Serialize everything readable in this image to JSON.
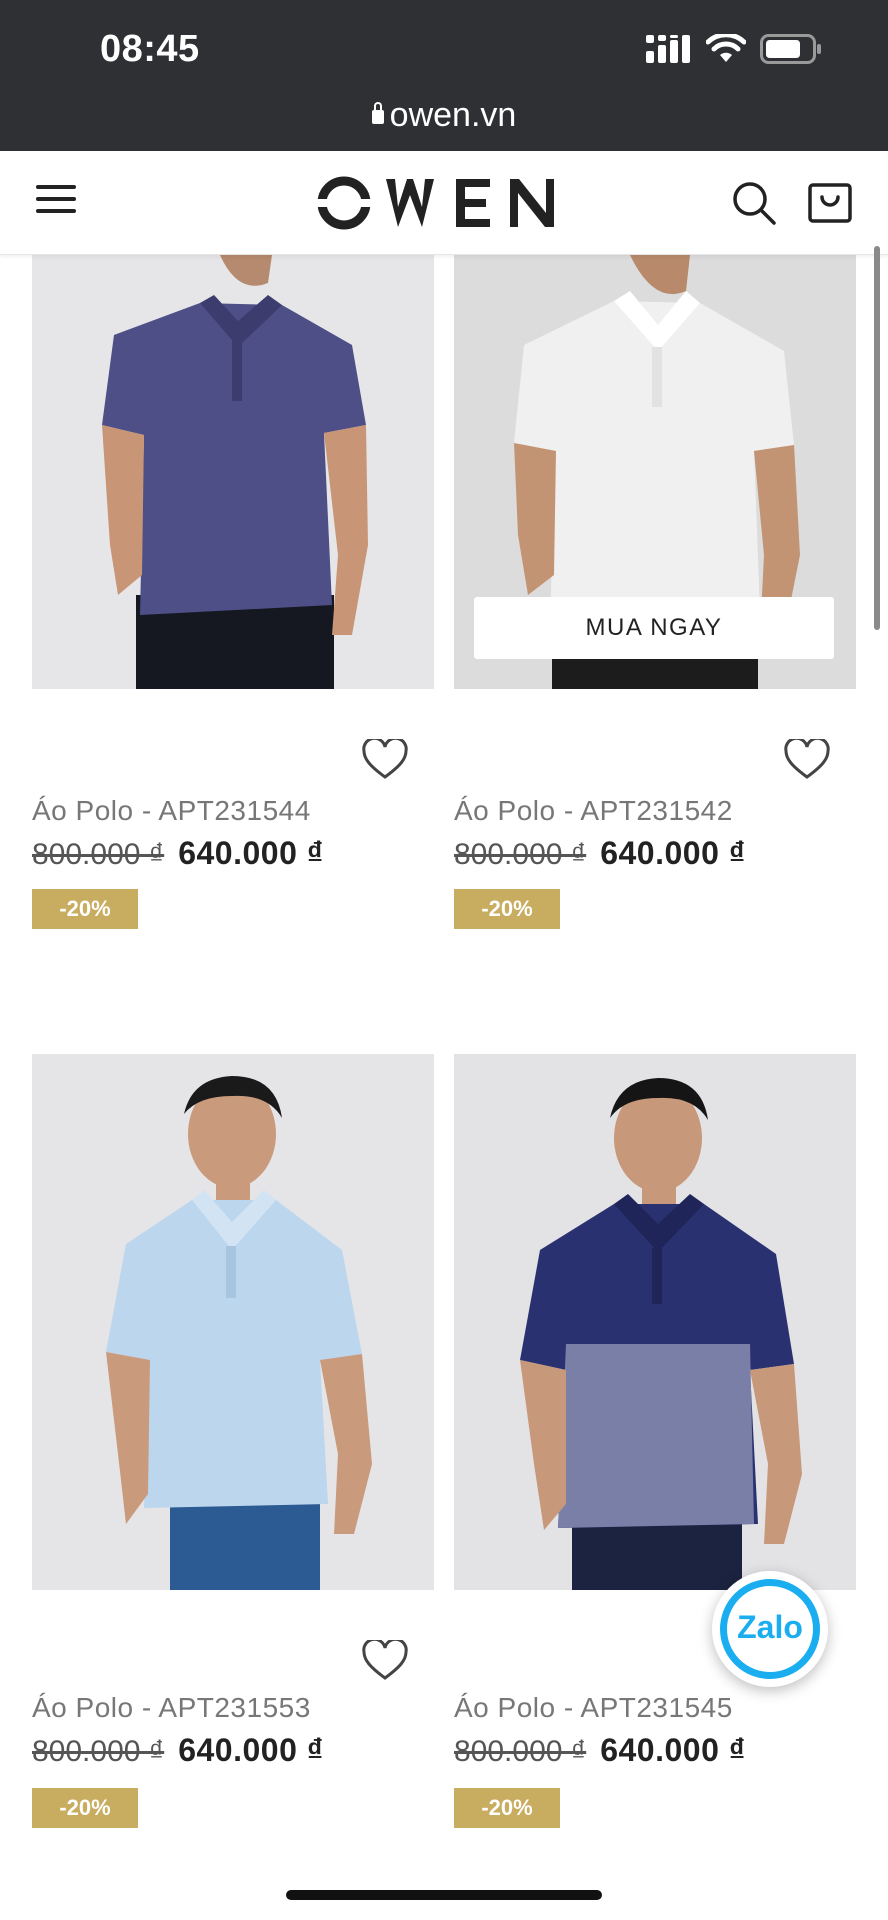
{
  "status_bar": {
    "time": "08:45",
    "icons": [
      "cellular-signal-icon",
      "wifi-icon",
      "battery-icon"
    ]
  },
  "browser": {
    "url": "owen.vn",
    "lock_icon": "lock-icon"
  },
  "header": {
    "logo_text": "OWEN",
    "menu_icon": "hamburger-menu-icon",
    "search_icon": "search-icon",
    "cart_icon": "shopping-bag-icon"
  },
  "colors": {
    "topbar": "#2f3033",
    "badge": "#c8ac5f",
    "zalo": "#1aaef0"
  },
  "products": [
    {
      "name": "Áo Polo - APT231544",
      "old_price": "800.000 ₫",
      "price": "640.000 ₫",
      "discount": "-20%",
      "shirt_color": "#4e4f86"
    },
    {
      "name": "Áo Polo - APT231542",
      "old_price": "800.000 ₫",
      "price": "640.000 ₫",
      "discount": "-20%",
      "shirt_color": "#f0f0f0",
      "buy_now": "MUA NGAY"
    },
    {
      "name": "Áo Polo - APT231553",
      "old_price": "800.000 ₫",
      "price": "640.000 ₫",
      "discount": "-20%",
      "shirt_color": "#bcd6ee"
    },
    {
      "name": "Áo Polo - APT231545",
      "old_price": "800.000 ₫",
      "price": "640.000 ₫",
      "discount": "-20%",
      "shirt_color": "#2a3170"
    }
  ],
  "zalo": {
    "label": "Zalo"
  }
}
